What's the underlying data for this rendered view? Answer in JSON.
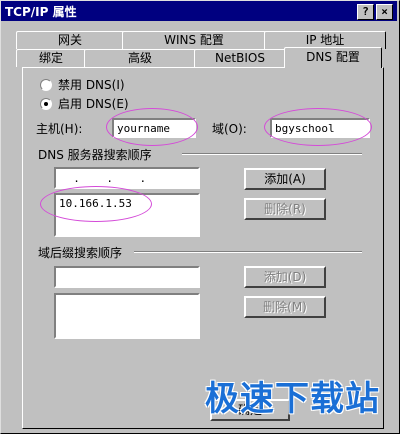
{
  "window": {
    "title": "TCP/IP 属性",
    "help_button": "?",
    "close_button": "×"
  },
  "tabs": {
    "row_back": [
      "网关",
      "WINS 配置",
      "IP 地址"
    ],
    "row_front": [
      "绑定",
      "高级",
      "NetBIOS",
      "DNS 配置"
    ],
    "active": "DNS 配置"
  },
  "dns": {
    "disable_label": "禁用 DNS(I)",
    "enable_label": "启用 DNS(E)",
    "selected": "enable",
    "host_label": "主机(H):",
    "host_value": "yourname",
    "domain_label": "域(O):",
    "domain_value": "bgyschool",
    "server_order_label": "DNS 服务器搜索顺序",
    "server_input_value": "  .    .    .",
    "server_list": [
      "10.166.1.53"
    ],
    "add_label": "添加(A)",
    "remove_label": "删除(R)"
  },
  "suffix": {
    "label": "域后缀搜索顺序",
    "input_value": "",
    "list": [],
    "add_label": "添加(D)",
    "remove_label": "删除(M)"
  },
  "footer": {
    "ok_label": "确定"
  },
  "watermark": {
    "text": "极速下载站"
  },
  "colors": {
    "title_bar": "#000080",
    "face": "#c0c0c0",
    "highlight_ellipse": "#d44bd8",
    "watermark": "#1a6fd6"
  }
}
